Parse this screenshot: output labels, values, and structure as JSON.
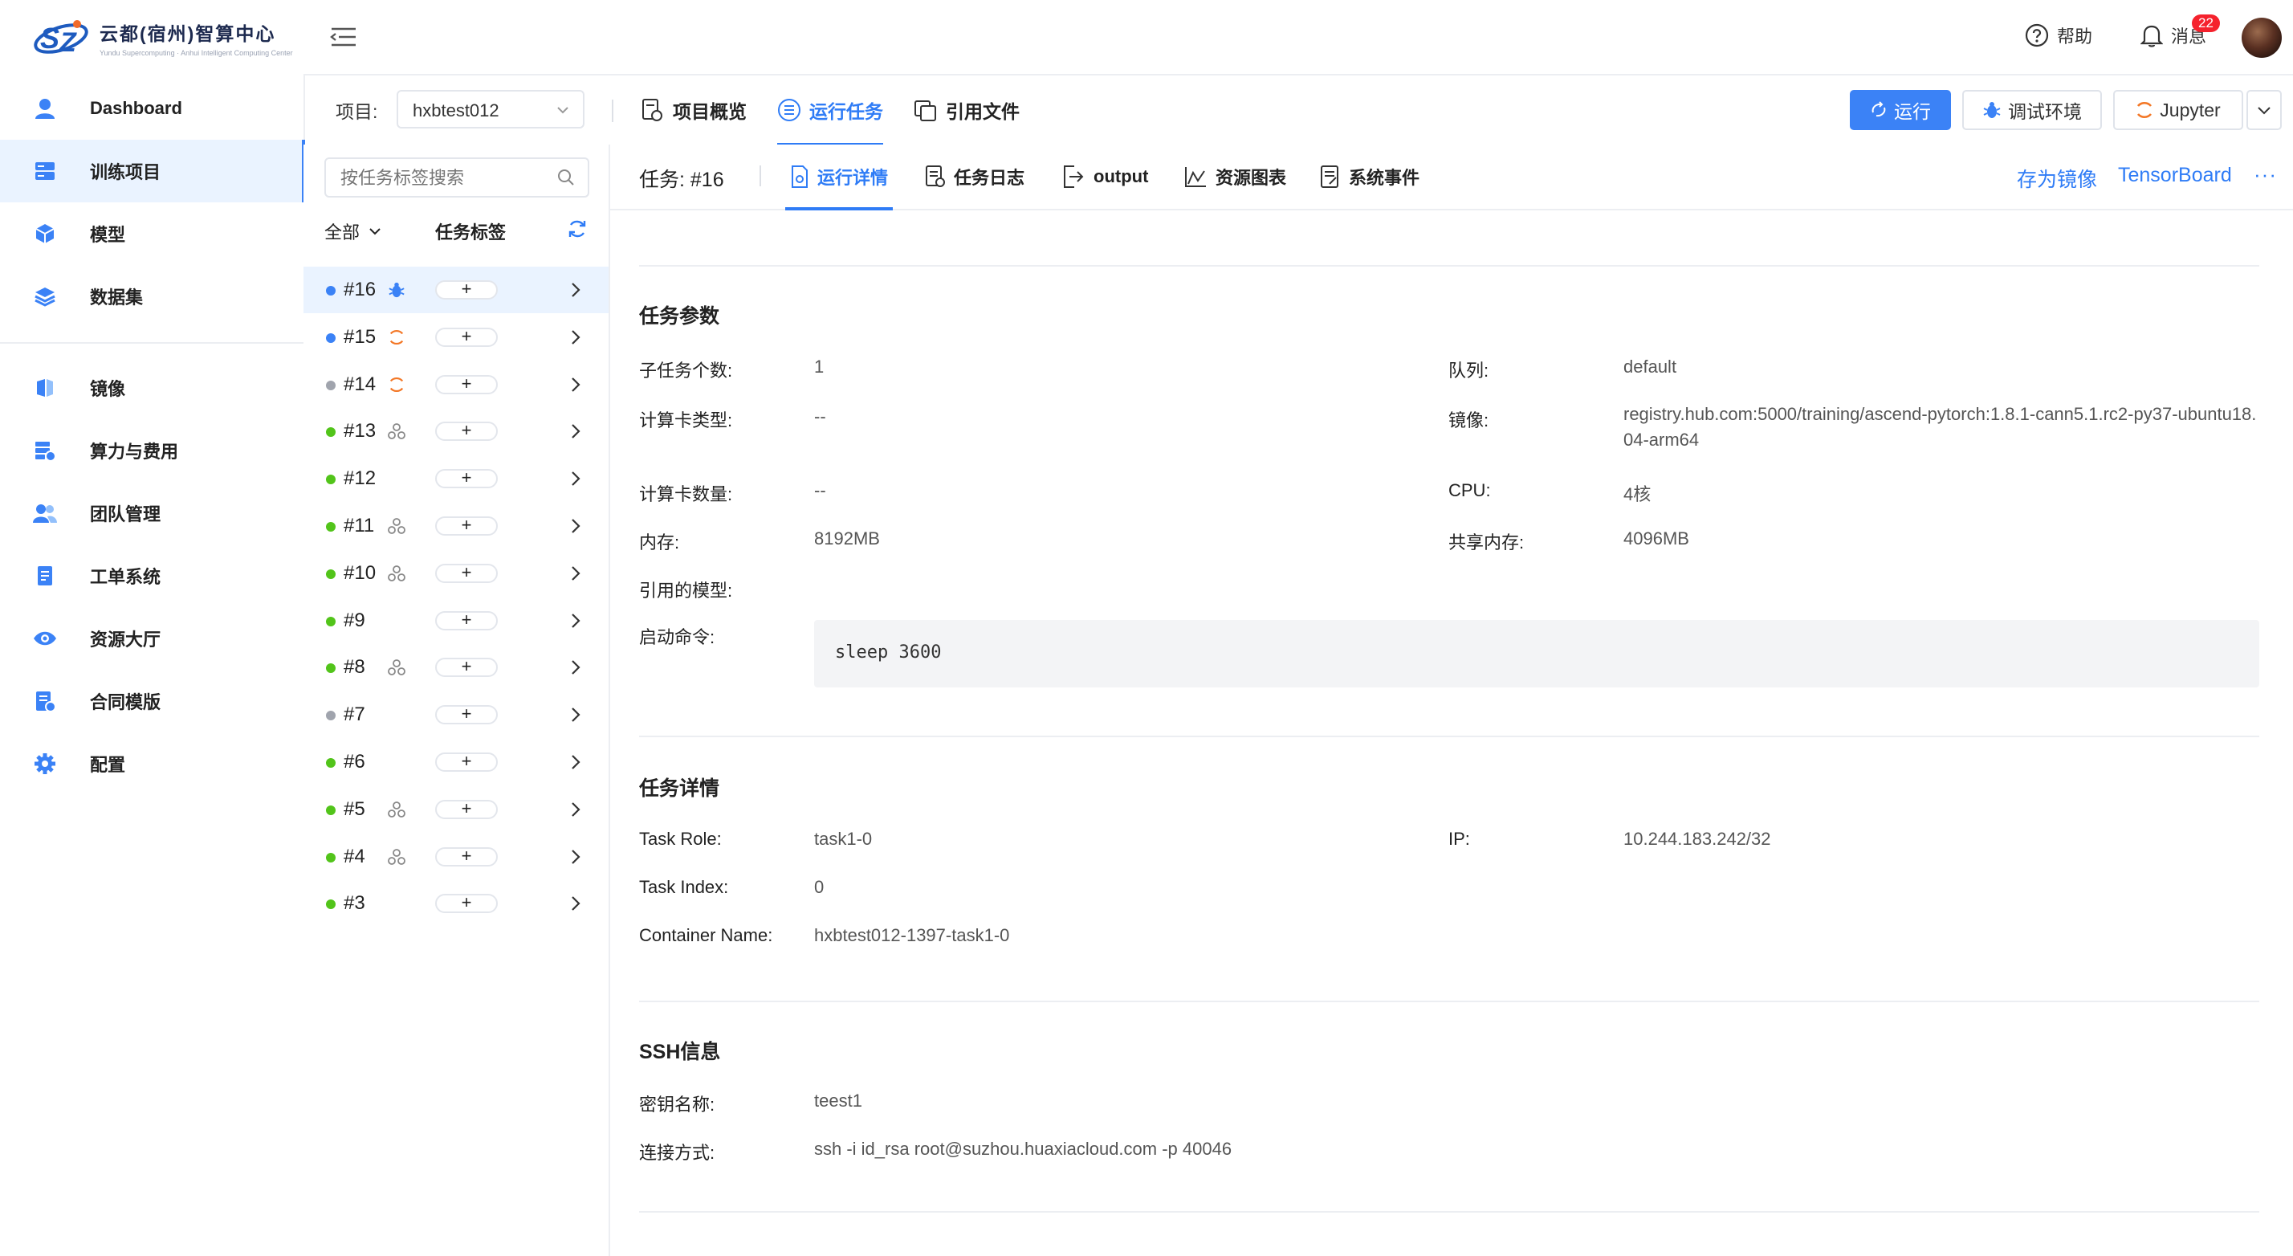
{
  "brand": {
    "title": "云都(宿州)智算中心",
    "subtitle": "Yundu Supercomputing · Anhui Intelligent Computing Center",
    "colors": {
      "primary": "#2f7cf6",
      "brand_blue": "#1e5bbf",
      "brand_orange": "#f26b2a"
    }
  },
  "sidebar": {
    "items": [
      {
        "label": "Dashboard",
        "icon": "user-icon"
      },
      {
        "label": "训练项目",
        "icon": "server-icon",
        "active": true
      },
      {
        "label": "模型",
        "icon": "cube-icon"
      },
      {
        "label": "数据集",
        "icon": "layers-icon"
      },
      {
        "label": "镜像",
        "icon": "mirror-icon"
      },
      {
        "label": "算力与费用",
        "icon": "compute-cost-icon"
      },
      {
        "label": "团队管理",
        "icon": "team-icon"
      },
      {
        "label": "工单系统",
        "icon": "ticket-icon"
      },
      {
        "label": "资源大厅",
        "icon": "eye-icon"
      },
      {
        "label": "合同模版",
        "icon": "contract-icon"
      },
      {
        "label": "配置",
        "icon": "gear-icon"
      }
    ]
  },
  "header": {
    "help_label": "帮助",
    "messages_label": "消息",
    "messages_count": "22"
  },
  "project": {
    "label": "项目:",
    "selected": "hxbtest012",
    "tabs": [
      {
        "label": "项目概览",
        "icon": "overview-icon"
      },
      {
        "label": "运行任务",
        "icon": "task-list-icon",
        "active": true
      },
      {
        "label": "引用文件",
        "icon": "files-icon"
      }
    ],
    "actions": {
      "run": "运行",
      "debug": "调试环境",
      "jupyter": "Jupyter"
    }
  },
  "tasklist": {
    "search_placeholder": "按任务标签搜索",
    "filter_all": "全部",
    "tag_column": "任务标签",
    "tasks": [
      {
        "id": "#16",
        "status_color": "#3b82f6",
        "icon": "bug-icon",
        "active": true
      },
      {
        "id": "#15",
        "status_color": "#3b82f6",
        "icon": "jupyter-icon"
      },
      {
        "id": "#14",
        "status_color": "#a0a4ad",
        "icon": "jupyter-icon"
      },
      {
        "id": "#13",
        "status_color": "#52c41a",
        "icon": "cluster-icon"
      },
      {
        "id": "#12",
        "status_color": "#52c41a",
        "icon": ""
      },
      {
        "id": "#11",
        "status_color": "#52c41a",
        "icon": "cluster-icon"
      },
      {
        "id": "#10",
        "status_color": "#52c41a",
        "icon": "cluster-icon"
      },
      {
        "id": "#9",
        "status_color": "#52c41a",
        "icon": ""
      },
      {
        "id": "#8",
        "status_color": "#52c41a",
        "icon": "cluster-icon"
      },
      {
        "id": "#7",
        "status_color": "#a0a4ad",
        "icon": ""
      },
      {
        "id": "#6",
        "status_color": "#52c41a",
        "icon": ""
      },
      {
        "id": "#5",
        "status_color": "#52c41a",
        "icon": "cluster-icon"
      },
      {
        "id": "#4",
        "status_color": "#52c41a",
        "icon": "cluster-icon"
      },
      {
        "id": "#3",
        "status_color": "#52c41a",
        "icon": ""
      }
    ],
    "tag_add": "+"
  },
  "task": {
    "label": "任务:  #16",
    "tabs": [
      {
        "label": "运行详情",
        "icon": "detail-icon",
        "active": true
      },
      {
        "label": "任务日志",
        "icon": "log-icon"
      },
      {
        "label": "output",
        "icon": "output-icon"
      },
      {
        "label": "资源图表",
        "icon": "chart-icon"
      },
      {
        "label": "系统事件",
        "icon": "event-icon"
      }
    ],
    "save_image": "存为镜像",
    "tensorboard": "TensorBoard",
    "more": "···"
  },
  "params": {
    "title": "任务参数",
    "subtasks_label": "子任务个数:",
    "subtasks": "1",
    "queue_label": "队列:",
    "queue": "default",
    "card_type_label": "计算卡类型:",
    "card_type": "--",
    "image_label": "镜像:",
    "image": "registry.hub.com:5000/training/ascend-pytorch:1.8.1-cann5.1.rc2-py37-ubuntu18.04-arm64",
    "card_count_label": "计算卡数量:",
    "card_count": "--",
    "cpu_label": "CPU:",
    "cpu": "4核",
    "memory_label": "内存:",
    "memory": "8192MB",
    "shm_label": "共享内存:",
    "shm": "4096MB",
    "model_label": "引用的模型:",
    "cmd_label": "启动命令:",
    "cmd": "sleep 3600"
  },
  "details": {
    "title": "任务详情",
    "role_label": "Task Role:",
    "role": "task1-0",
    "ip_label": "IP:",
    "ip": "10.244.183.242/32",
    "index_label": "Task Index:",
    "index": "0",
    "container_label": "Container Name:",
    "container": "hxbtest012-1397-task1-0"
  },
  "ssh": {
    "title": "SSH信息",
    "key_label": "密钥名称:",
    "key": "teest1",
    "conn_label": "连接方式:",
    "conn": "ssh -i id_rsa root@suzhou.huaxiacloud.com -p 40046"
  }
}
